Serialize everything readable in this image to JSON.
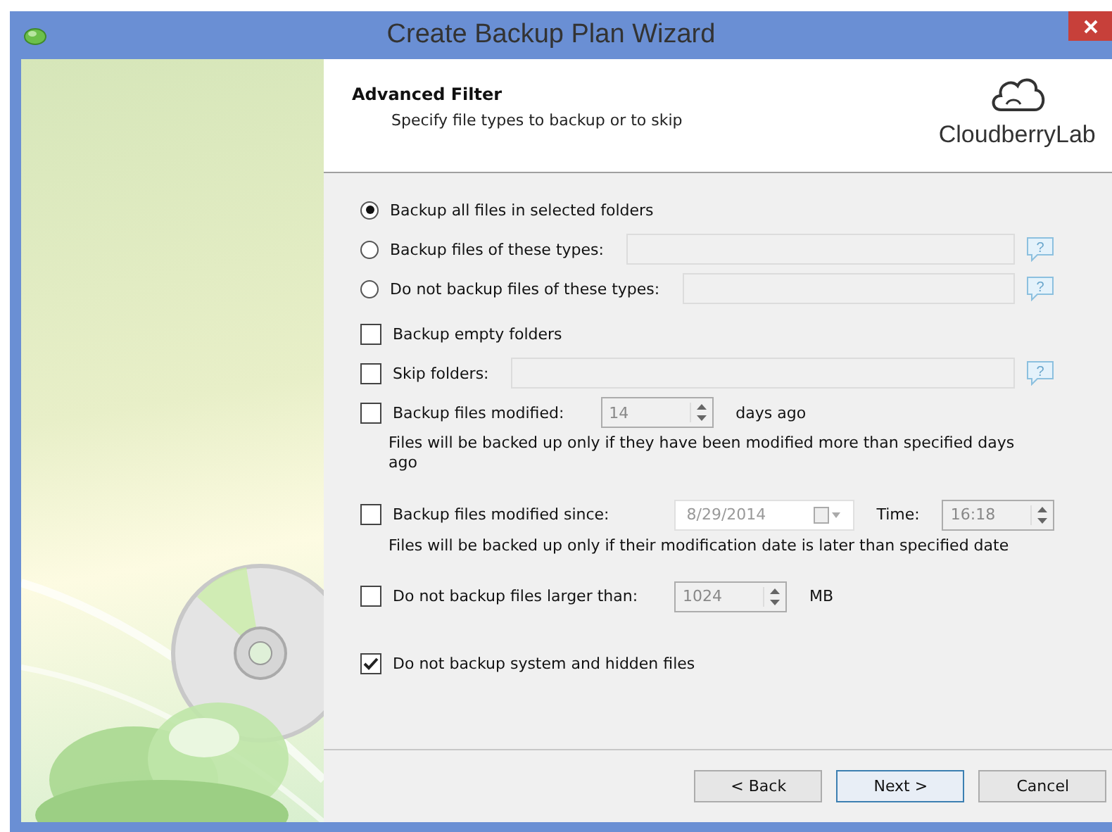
{
  "window": {
    "title": "Create Backup Plan Wizard"
  },
  "header": {
    "title": "Advanced Filter",
    "subtitle": "Specify file types to backup or to skip",
    "logo_text": "CloudberryLab"
  },
  "options": [
    {
      "kind": "radio",
      "label": "Backup all files in selected folders",
      "selected": true
    },
    {
      "kind": "radio",
      "label": "Backup files of these types:",
      "selected": false,
      "extras": [
        {
          "kind": "text-field"
        },
        {
          "kind": "help",
          "text": "?"
        }
      ]
    },
    {
      "kind": "radio",
      "label": "Do not backup files of these types:",
      "selected": false,
      "extras": [
        {
          "kind": "text-field"
        },
        {
          "kind": "help",
          "text": "?"
        }
      ]
    },
    {
      "kind": "checkbox",
      "label": "Backup empty folders",
      "checked": false
    },
    {
      "kind": "checkbox",
      "label": "Skip folders:",
      "checked": false,
      "extras": [
        {
          "kind": "text-field"
        },
        {
          "kind": "help",
          "text": "?"
        }
      ]
    },
    {
      "kind": "checkbox",
      "label": "Backup files modified:",
      "checked": false,
      "extras": [
        {
          "kind": "spinner",
          "value": "14"
        },
        {
          "kind": "label",
          "text": "days ago"
        }
      ],
      "note": "Files will be backed up only if they have been modified more than specified days ago"
    },
    {
      "kind": "checkbox",
      "label": "Backup files modified since:",
      "checked": false,
      "extras": [
        {
          "kind": "date-picker",
          "value": "8/29/2014"
        },
        {
          "kind": "label",
          "text": "Time:"
        },
        {
          "kind": "spinner",
          "value": "16:18"
        }
      ],
      "note": "Files will be backed up only if their modification date is later than specified date"
    },
    {
      "kind": "checkbox",
      "label": "Do not backup files larger than:",
      "checked": false,
      "extras": [
        {
          "kind": "spinner",
          "value": "1024"
        },
        {
          "kind": "label",
          "text": "MB"
        }
      ]
    },
    {
      "kind": "checkbox",
      "label": "Do not backup system and hidden files",
      "checked": true
    }
  ],
  "buttons": [
    {
      "label": "< Back",
      "default": false
    },
    {
      "label": "Next >",
      "default": true
    },
    {
      "label": "Cancel",
      "default": false
    }
  ]
}
